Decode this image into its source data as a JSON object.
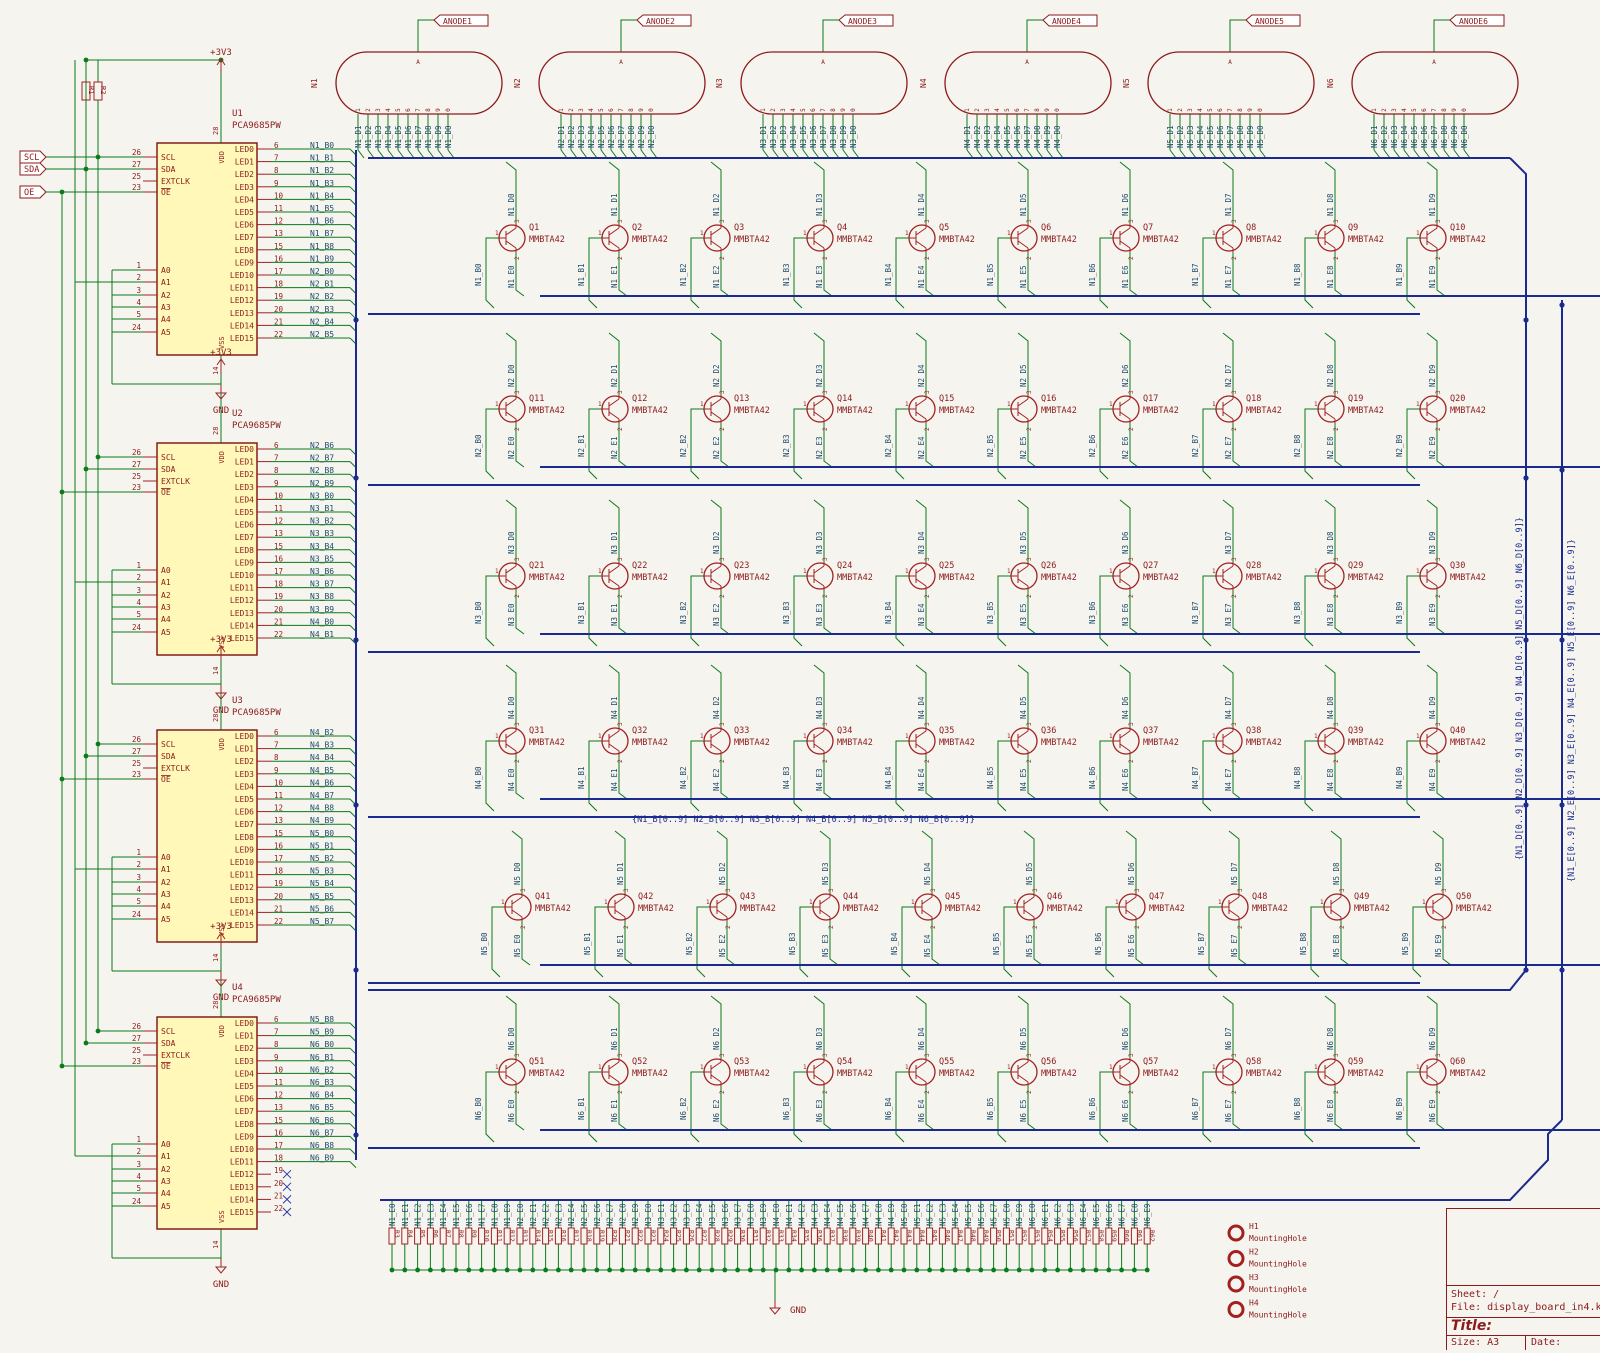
{
  "sheet": {
    "title_label": "Title:",
    "sheet_label": "Sheet: /",
    "file_label": "File: display_board_in4.kicad_sch",
    "size_label": "Size: A3",
    "date_label": "Date:"
  },
  "power": {
    "vdd": "+3V3",
    "gnd": "GND"
  },
  "global_labels": [
    "SCL",
    "SDA",
    "OE"
  ],
  "pull_resistors": [
    "R1",
    "R2"
  ],
  "tubes": [
    {
      "ref": "N1",
      "anode": "ANODE1"
    },
    {
      "ref": "N2",
      "anode": "ANODE2"
    },
    {
      "ref": "N3",
      "anode": "ANODE3"
    },
    {
      "ref": "N4",
      "anode": "ANODE4"
    },
    {
      "ref": "N5",
      "anode": "ANODE5"
    },
    {
      "ref": "N6",
      "anode": "ANODE6"
    }
  ],
  "tube_anode_pin": "A",
  "tube_pins": [
    "1",
    "2",
    "3",
    "4",
    "5",
    "6",
    "7",
    "8",
    "9",
    "0"
  ],
  "drivers": [
    {
      "ref": "U1",
      "value": "PCA9685PW",
      "nets": [
        "N1_B0",
        "N1_B1",
        "N1_B2",
        "N1_B3",
        "N1_B4",
        "N1_B5",
        "N1_B6",
        "N1_B7",
        "N1_B8",
        "N1_B9",
        "N2_B0",
        "N2_B1",
        "N2_B2",
        "N2_B3",
        "N2_B4",
        "N2_B5"
      ]
    },
    {
      "ref": "U2",
      "value": "PCA9685PW",
      "nets": [
        "N2_B6",
        "N2_B7",
        "N2_B8",
        "N2_B9",
        "N3_B0",
        "N3_B1",
        "N3_B2",
        "N3_B3",
        "N3_B4",
        "N3_B5",
        "N3_B6",
        "N3_B7",
        "N3_B8",
        "N3_B9",
        "N4_B0",
        "N4_B1"
      ]
    },
    {
      "ref": "U3",
      "value": "PCA9685PW",
      "nets": [
        "N4_B2",
        "N4_B3",
        "N4_B4",
        "N4_B5",
        "N4_B6",
        "N4_B7",
        "N4_B8",
        "N4_B9",
        "N5_B0",
        "N5_B1",
        "N5_B2",
        "N5_B3",
        "N5_B4",
        "N5_B5",
        "N5_B6",
        "N5_B7"
      ]
    },
    {
      "ref": "U4",
      "value": "PCA9685PW",
      "nets": [
        "N5_B8",
        "N5_B9",
        "N6_B0",
        "N6_B1",
        "N6_B2",
        "N6_B3",
        "N6_B4",
        "N6_B5",
        "N6_B6",
        "N6_B7",
        "N6_B8",
        "N6_B9",
        "",
        "",
        "",
        ""
      ]
    }
  ],
  "ic_left_pins": [
    {
      "num": "26",
      "name": "SCL"
    },
    {
      "num": "27",
      "name": "SDA"
    },
    {
      "num": "25",
      "name": "EXTCLK"
    },
    {
      "num": "23",
      "name": "OE"
    },
    {
      "num": "1",
      "name": "A0"
    },
    {
      "num": "2",
      "name": "A1"
    },
    {
      "num": "3",
      "name": "A2"
    },
    {
      "num": "4",
      "name": "A3"
    },
    {
      "num": "5",
      "name": "A4"
    },
    {
      "num": "24",
      "name": "A5"
    }
  ],
  "ic_right_pins": [
    "LED0",
    "LED1",
    "LED2",
    "LED3",
    "LED4",
    "LED5",
    "LED6",
    "LED7",
    "LED8",
    "LED9",
    "LED10",
    "LED11",
    "LED12",
    "LED13",
    "LED14",
    "LED15"
  ],
  "ic_right_nums": [
    "6",
    "7",
    "8",
    "9",
    "10",
    "11",
    "12",
    "13",
    "15",
    "16",
    "17",
    "18",
    "19",
    "20",
    "21",
    "22"
  ],
  "ic_vdd": {
    "num": "28",
    "name": "VDD"
  },
  "ic_vss": {
    "num": "14",
    "name": "VSS"
  },
  "transistor_value": "MMBTA42",
  "transistor_pin_nums": [
    "1",
    "2",
    "3"
  ],
  "bus_label": "{N1_B[0..9] N2_B[0..9] N3_B[0..9] N4_B[0..9] N5_B[0..9] N6_B[0..9]}",
  "vbus_labels": [
    "{N1_D[0..9] N2_D[0..9] N3_D[0..9] N4_D[0..9] N5_D[0..9] N6_D[0..9]}",
    "{N1_E[0..9] N2_E[0..9] N3_E[0..9] N4_E[0..9] N5_E[0..9] N6_E[0..9]}"
  ],
  "mounting_holes": [
    {
      "ref": "H1",
      "value": "MountingHole"
    },
    {
      "ref": "H2",
      "value": "MountingHole"
    },
    {
      "ref": "H3",
      "value": "MountingHole"
    },
    {
      "ref": "H4",
      "value": "MountingHole"
    }
  ]
}
